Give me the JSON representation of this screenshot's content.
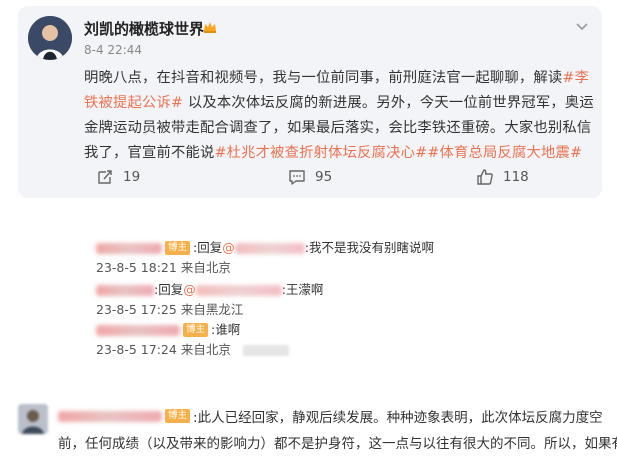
{
  "post": {
    "author": "刘凯的橄榄球世界",
    "author_badge_icon": "crown-icon",
    "time": "8-4 22:44",
    "body": [
      {
        "t": "明晚八点，在抖音和视频号，我与一位前同事，前刑庭法官一起聊聊，解读"
      },
      {
        "t": "#李铁被提起公诉#",
        "tag": true
      },
      {
        "t": " 以及本次体坛反腐的新进展。另外，今天一位前世界冠军，奥运金牌运动员被带走配合调查了，如果最后落实，会比李铁还重磅。大家也别私信我了，官宣前不能说"
      },
      {
        "t": "#杜兆才被查折射体坛反腐决心#",
        "tag": true
      },
      {
        "t": "#体育总局反腐大地震#",
        "tag": true
      }
    ],
    "actions": {
      "repost_count": "19",
      "comment_count": "95",
      "like_count": "118"
    },
    "colors": {
      "accent": "#eb7350",
      "card": "#f3f4f8",
      "badge": "#f5b04a"
    }
  },
  "replies": [
    {
      "badge": "博主",
      "prefix": ":回复",
      "mention_at": "@",
      "text": ":我不是我没有别瞎说啊",
      "time": "23-8-5 18:21",
      "location": "来自北京"
    },
    {
      "badge": "",
      "prefix": ":回复",
      "mention_at": "@",
      "text": ":王濛啊",
      "time": "23-8-5 17:25",
      "location": "来自黑龙江"
    },
    {
      "badge": "博主",
      "prefix": "",
      "mention_at": "",
      "text": ":谁啊",
      "time": "23-8-5 17:24",
      "location": "来自北京"
    }
  ],
  "comment": {
    "badge": "博主",
    "line1": ":此人已经回家，静观后续发展。种种迹象表明，此次体坛反腐力度空",
    "line2": "前，任何成绩（以及带来的影响力）都不是护身符，这一点与以往有很大的不同。所以，如果有"
  }
}
